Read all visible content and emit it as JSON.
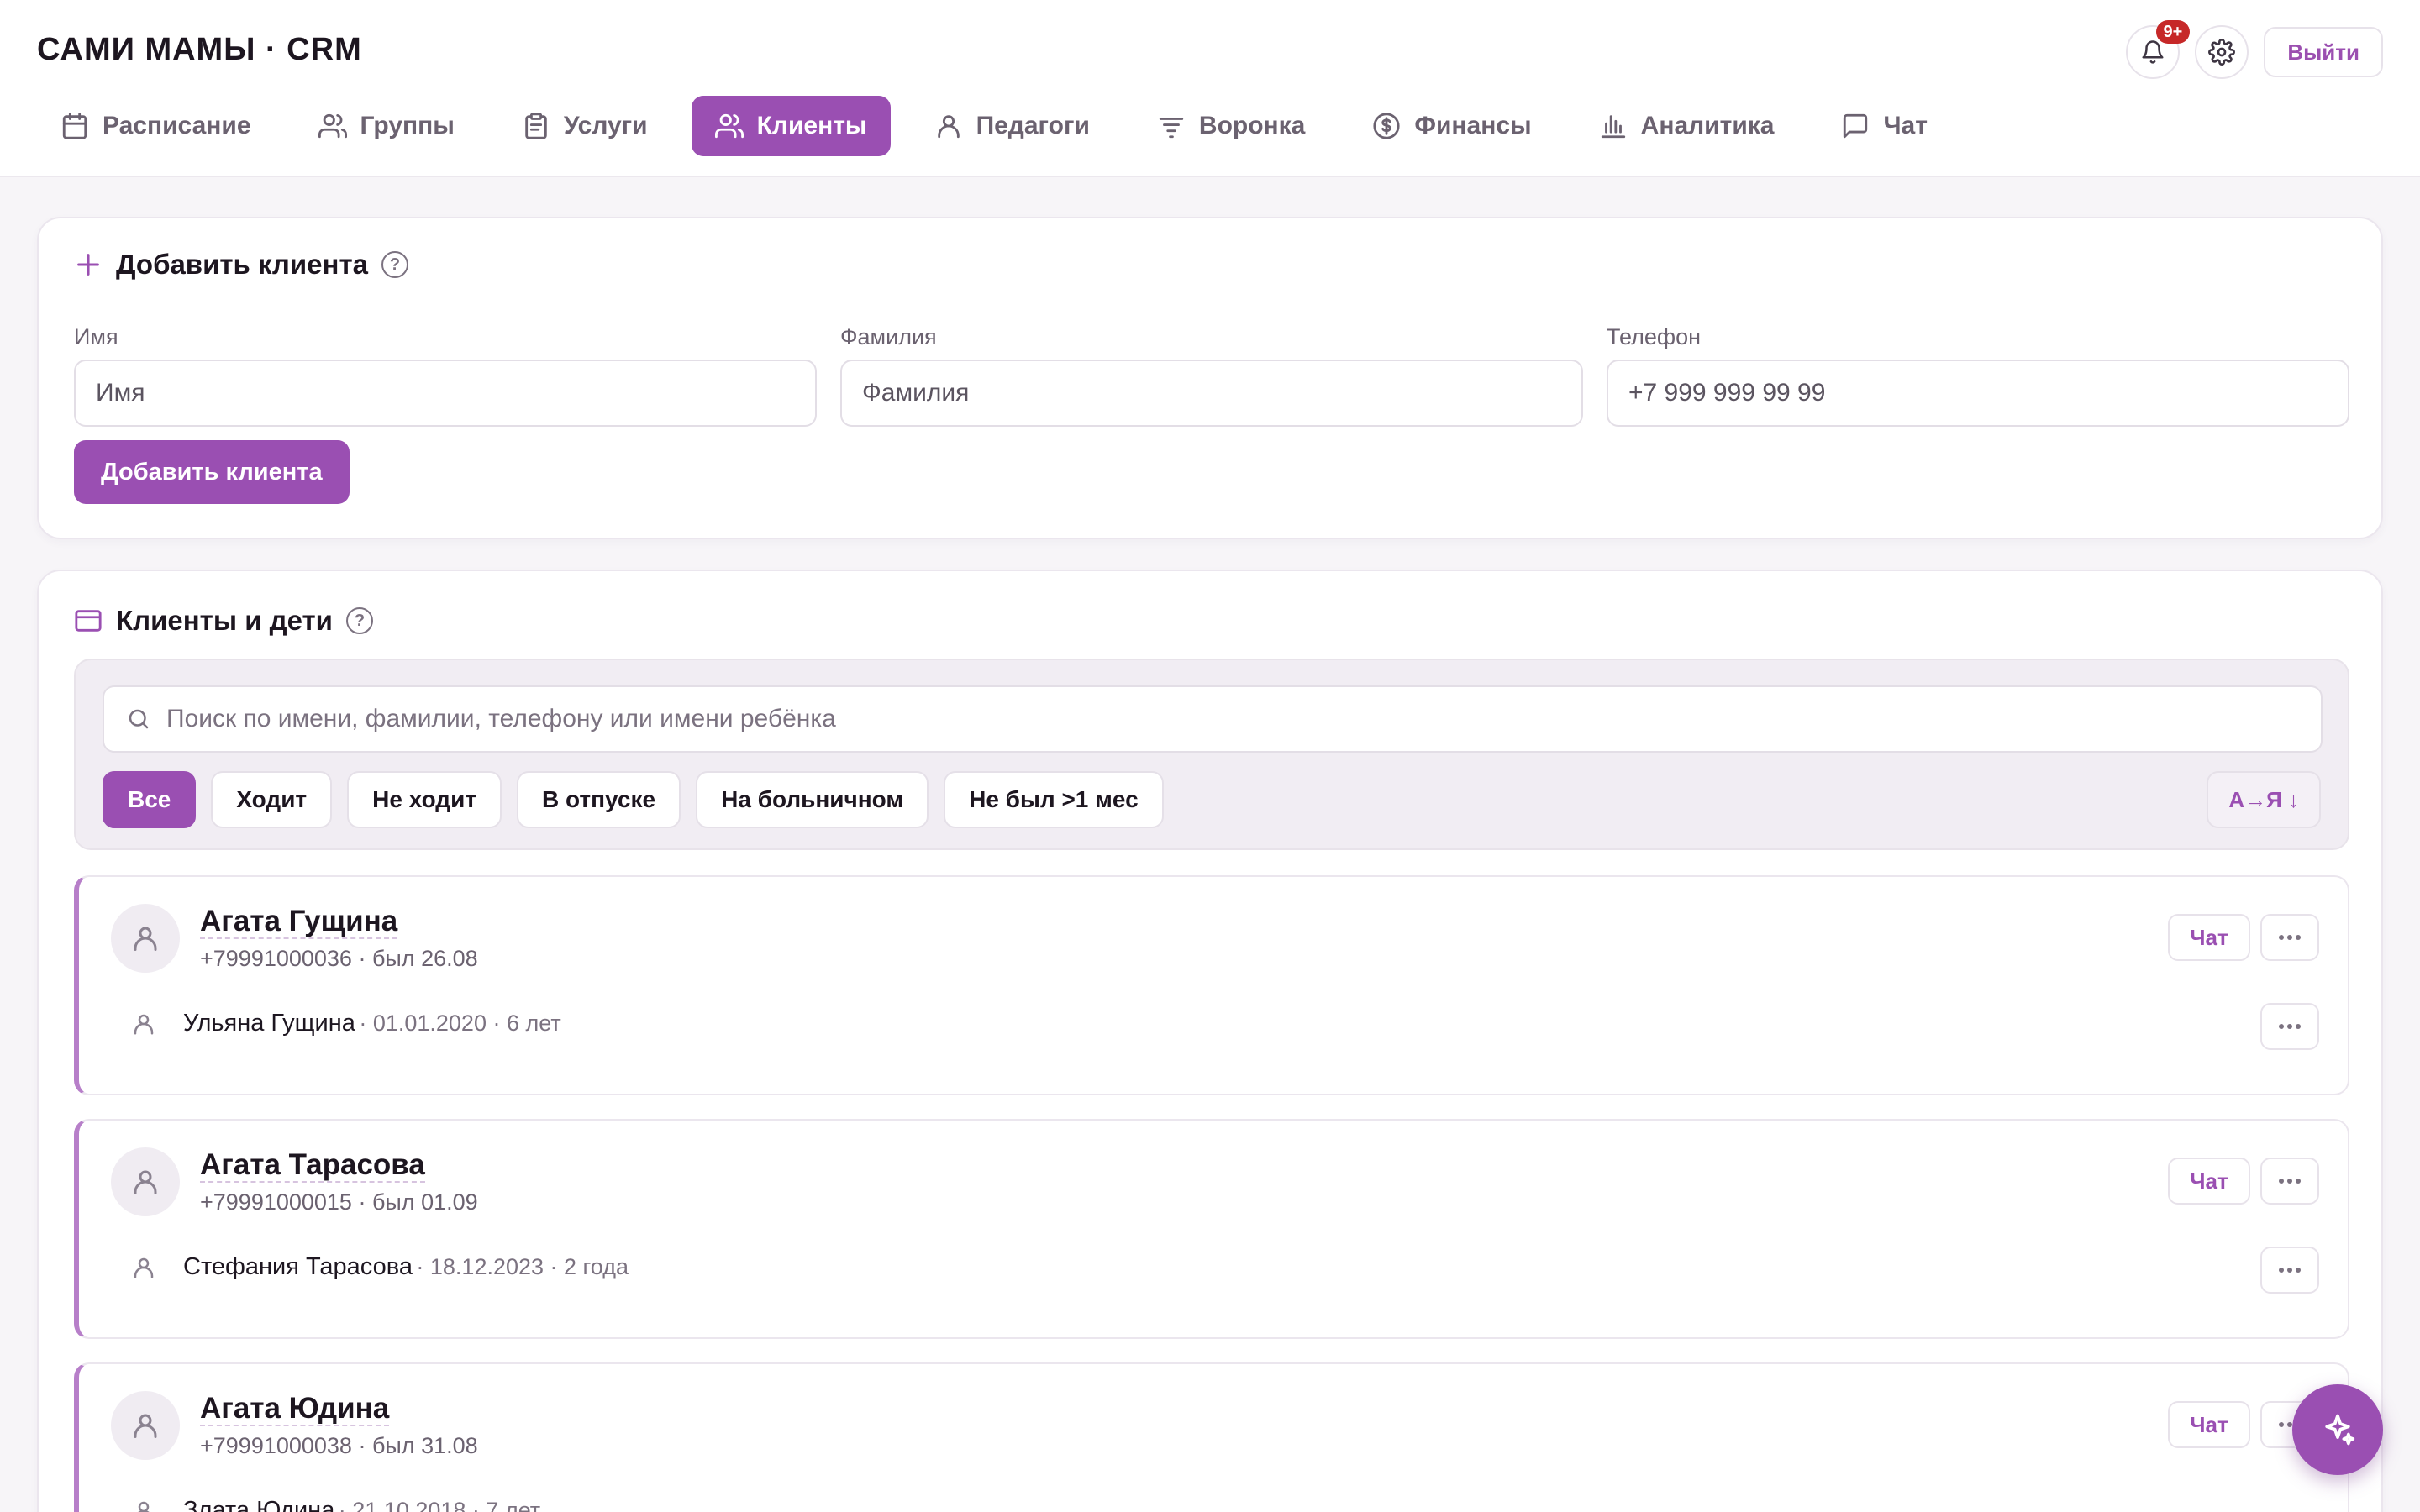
{
  "app": {
    "title": "САМИ МАМЫ · CRM",
    "notifications_badge": "9+",
    "logout_label": "Выйти"
  },
  "nav": [
    {
      "label": "Расписание",
      "icon": "calendar-icon"
    },
    {
      "label": "Группы",
      "icon": "users-icon"
    },
    {
      "label": "Услуги",
      "icon": "clipboard-icon"
    },
    {
      "label": "Клиенты",
      "icon": "users-icon",
      "active": true
    },
    {
      "label": "Педагоги",
      "icon": "user-icon"
    },
    {
      "label": "Воронка",
      "icon": "filter-icon"
    },
    {
      "label": "Финансы",
      "icon": "dollar-icon"
    },
    {
      "label": "Аналитика",
      "icon": "bar-chart-icon"
    },
    {
      "label": "Чат",
      "icon": "message-icon"
    }
  ],
  "add_client": {
    "title": "Добавить клиента",
    "first_name": {
      "label": "Имя",
      "placeholder": "Имя"
    },
    "last_name": {
      "label": "Фамилия",
      "placeholder": "Фамилия"
    },
    "phone": {
      "label": "Телефон",
      "placeholder": "+7 999 999 99 99"
    },
    "submit_label": "Добавить клиента"
  },
  "clients_section": {
    "title": "Клиенты и дети",
    "search_placeholder": "Поиск по имени, фамилии, телефону или имени ребёнка",
    "filters": [
      "Все",
      "Ходит",
      "Не ходит",
      "В отпуске",
      "На больничном",
      "Не был >1 мес"
    ],
    "active_filter": "Все",
    "sort_label": "А→Я ↓"
  },
  "clients": [
    {
      "name": "Агата Гущина",
      "meta": "+79991000036 · был 26.08",
      "chat_label": "Чат",
      "child": {
        "name": "Ульяна Гущина",
        "meta": "· 01.01.2020 · 6 лет"
      }
    },
    {
      "name": "Агата Тарасова",
      "meta": "+79991000015 · был 01.09",
      "chat_label": "Чат",
      "child": {
        "name": "Стефания Тарасова",
        "meta": "· 18.12.2023 · 2 года"
      }
    },
    {
      "name": "Агата Юдина",
      "meta": "+79991000038 · был 31.08",
      "chat_label": "Чат",
      "child": {
        "name": "Злата Юдина",
        "meta": "· 21.10.2018 · 7 лет"
      }
    }
  ],
  "colors": {
    "accent": "#9a4fb2",
    "badge": "#c62828",
    "background": "#f7f5f8"
  }
}
